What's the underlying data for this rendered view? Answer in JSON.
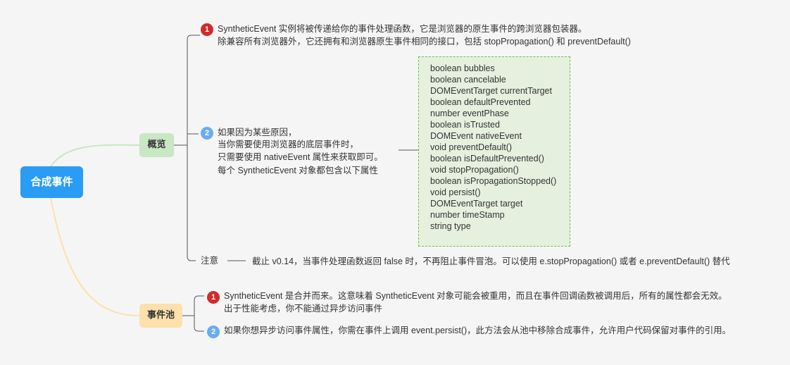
{
  "root": {
    "label": "合成事件"
  },
  "overview": {
    "label": "概览",
    "item1": {
      "num": "1",
      "line1": "SyntheticEvent 实例将被传递给你的事件处理函数，它是浏览器的原生事件的跨浏览器包装器。",
      "line2": "除兼容所有浏览器外，它还拥有和浏览器原生事件相同的接口，包括 stopPropagation() 和 preventDefault()"
    },
    "item2": {
      "num": "2",
      "lines": [
        "如果因为某些原因，",
        "当你需要使用浏览器的底层事件时，",
        "只需要使用 nativeEvent 属性来获取即可。",
        "每个 SyntheticEvent 对象都包含以下属性"
      ],
      "properties": [
        "boolean bubbles",
        "boolean cancelable",
        "DOMEventTarget currentTarget",
        "boolean defaultPrevented",
        "number eventPhase",
        "boolean isTrusted",
        "DOMEvent nativeEvent",
        "void preventDefault()",
        "boolean isDefaultPrevented()",
        "void stopPropagation()",
        "boolean isPropagationStopped()",
        "void persist()",
        "DOMEventTarget target",
        "number timeStamp",
        "string type"
      ]
    },
    "note": {
      "label": "注意",
      "text": "截止 v0.14，当事件处理函数返回 false 时，不再阻止事件冒泡。可以使用 e.stopPropagation() 或者 e.preventDefault() 替代"
    }
  },
  "pool": {
    "label": "事件池",
    "item1": {
      "num": "1",
      "line1": "SyntheticEvent 是合并而来。这意味着 SyntheticEvent 对象可能会被重用，而且在事件回调函数被调用后，所有的属性都会无效。",
      "line2": "出于性能考虑，你不能通过异步访问事件"
    },
    "item2": {
      "num": "2",
      "line1": "如果你想异步访问事件属性，你需在事件上调用 event.persist()，此方法会从池中移除合成事件，允许用户代码保留对事件的引用。"
    }
  },
  "colors": {
    "root": "#2a9cf3",
    "overview": "#c9e6c5",
    "pool": "#fde0ac",
    "badge_red": "#d12a2a",
    "badge_blue": "#69acf0"
  }
}
